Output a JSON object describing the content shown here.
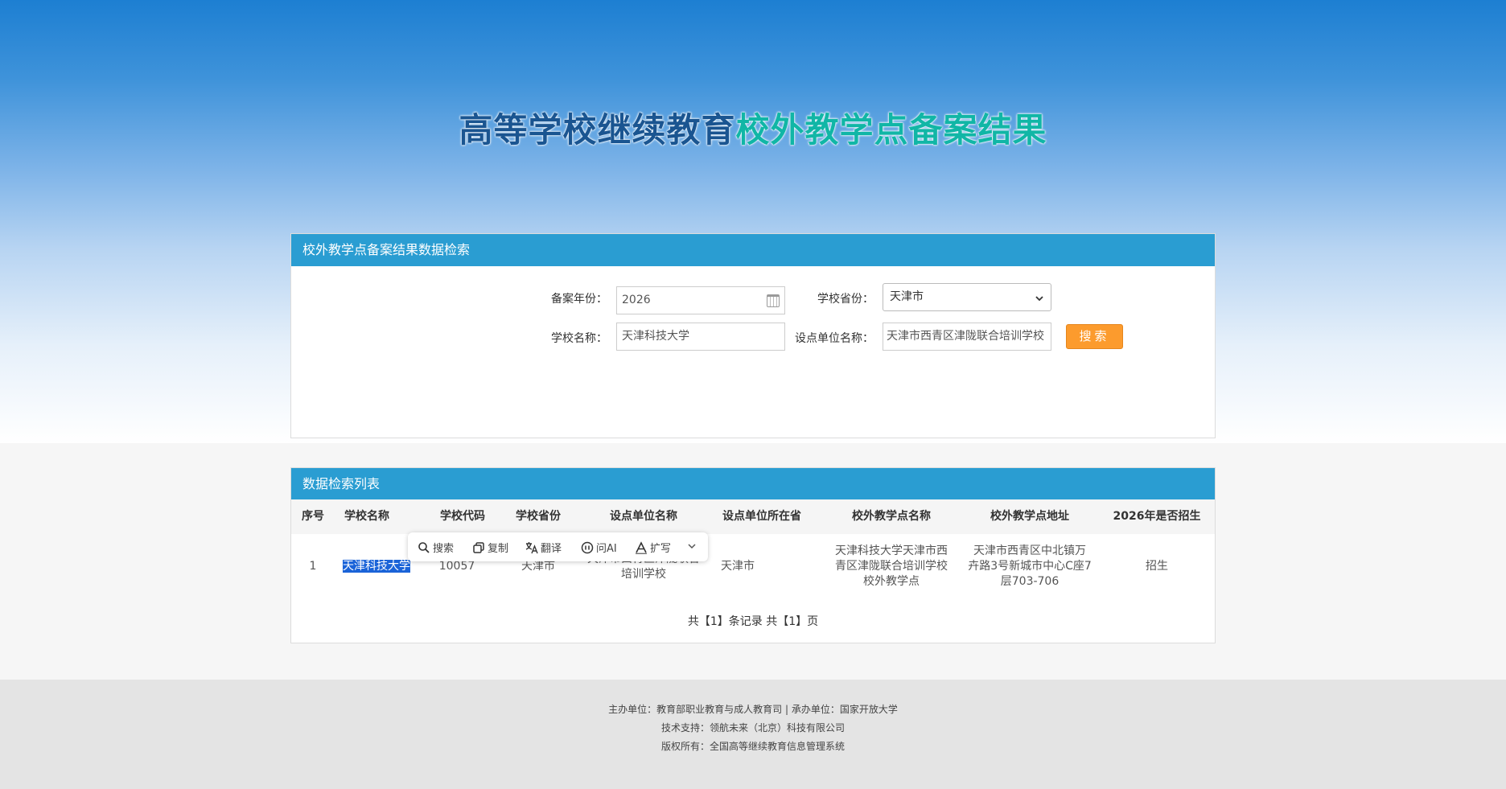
{
  "header": {
    "title_part1": "高等学校继续教育",
    "title_part2": "校外教学点备案结果"
  },
  "search": {
    "panel_title": "校外教学点备案结果数据检索",
    "year_label": "备案年份：",
    "year_value": "2026",
    "province_label": "学校省份：",
    "province_value": "天津市",
    "school_label": "学校名称：",
    "school_value": "天津科技大学",
    "unit_label": "设点单位名称：",
    "unit_value": "天津市西青区津陇联合培训学校",
    "button_label": "搜索"
  },
  "list": {
    "panel_title": "数据检索列表",
    "columns": [
      "序号",
      "学校名称",
      "学校代码",
      "学校省份",
      "设点单位名称",
      "设点单位所在省",
      "校外教学点名称",
      "校外教学点地址",
      "2026年是否招生"
    ],
    "rows": [
      {
        "index": "1",
        "school_name": "天津科技大学",
        "school_code": "10057",
        "school_province": "天津市",
        "unit_name_line1": "天津市西青区津陇联合",
        "unit_name_line2": "培训学校",
        "unit_province": "天津市",
        "point_name_line1": "天津科技大学天津市西",
        "point_name_line2": "青区津陇联合培训学校",
        "point_name_line3": "校外教学点",
        "address_line1": "天津市西青区中北镇万",
        "address_line2": "卉路3号新城市中心C座7",
        "address_line3": "层703-706",
        "enrolling": "招生"
      }
    ],
    "pagination": "共【1】条记录 共【1】页"
  },
  "toolbar": {
    "search": "搜索",
    "copy": "复制",
    "translate": "翻译",
    "ask_ai": "问AI",
    "expand": "扩写"
  },
  "footer": {
    "line1": "主办单位：教育部职业教育与成人教育司 | 承办单位：国家开放大学",
    "line2": "技术支持：领航未来（北京）科技有限公司",
    "line3": "版权所有：全国高等继续教育信息管理系统"
  }
}
